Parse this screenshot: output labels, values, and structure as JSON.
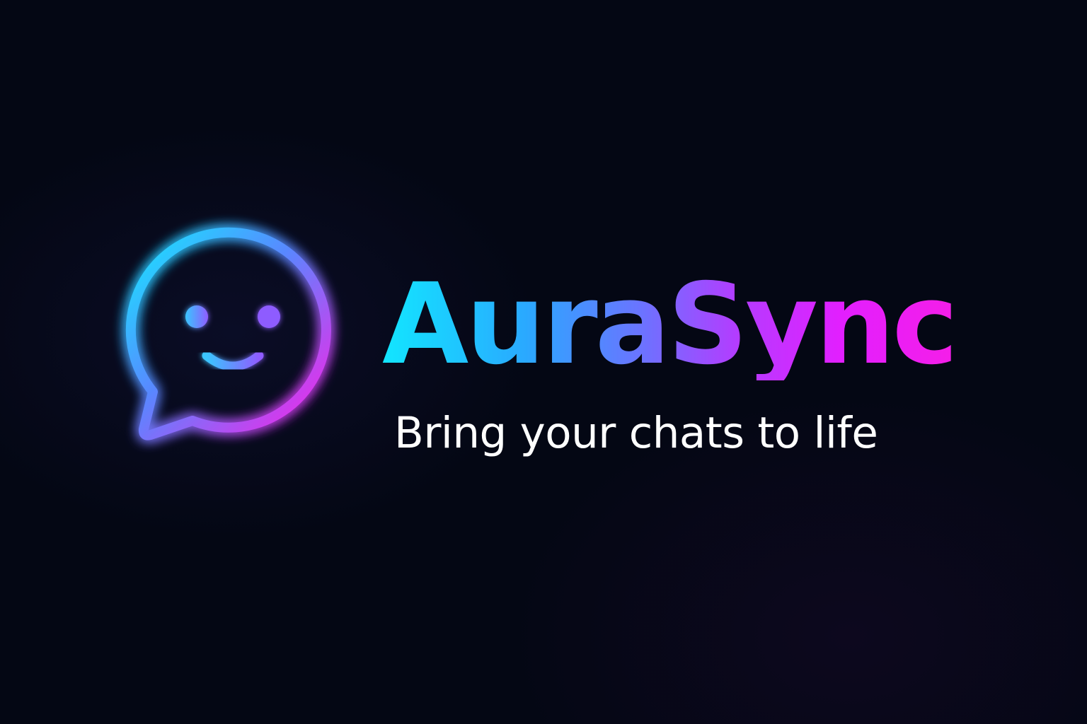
{
  "brand": {
    "name": "AuraSync",
    "tagline": "Bring your chats to life",
    "logo_icon": "smiling-chat-bubble-icon"
  },
  "colors": {
    "background": "#040714",
    "gradient_start": "#12e6ff",
    "gradient_mid": "#6a74ff",
    "gradient_end": "#f51ee8",
    "tagline": "#ffffff"
  }
}
